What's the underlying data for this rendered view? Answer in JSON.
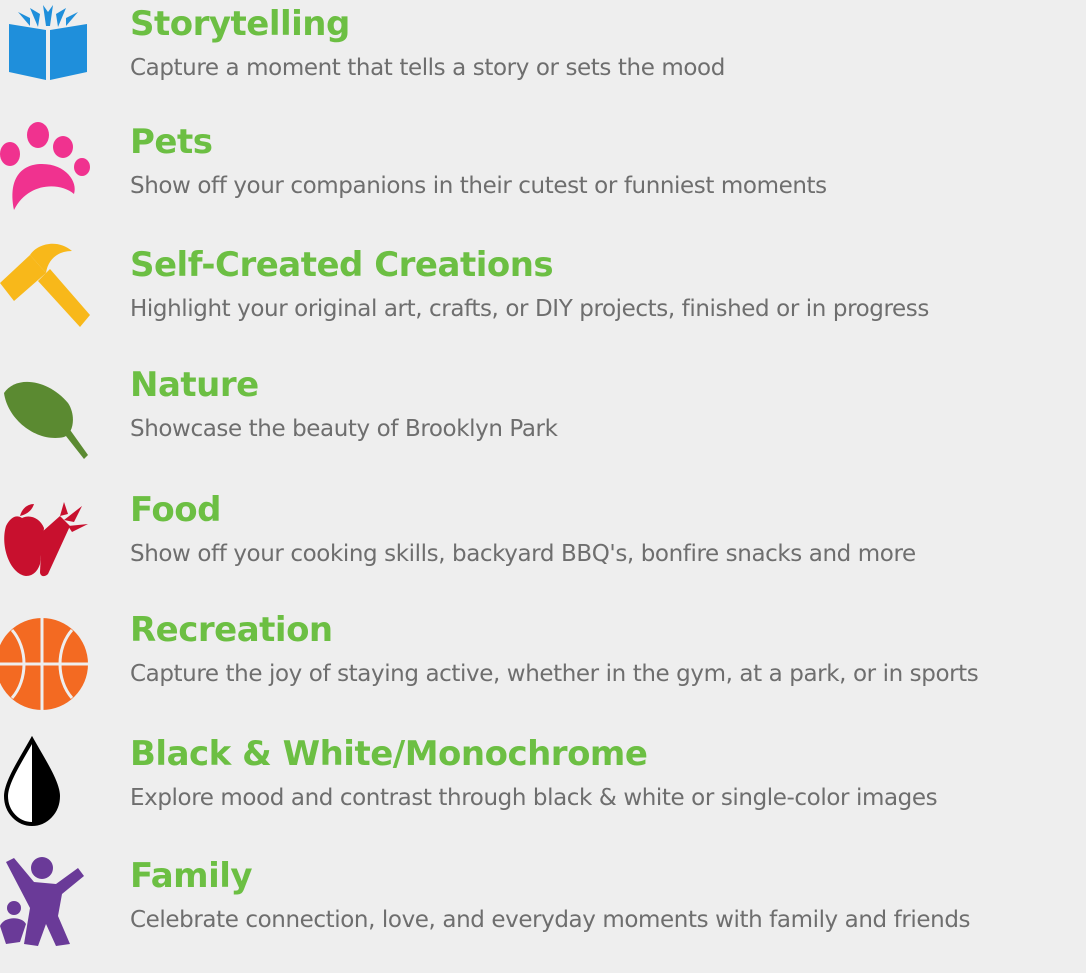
{
  "colors": {
    "title": "#6cbf43",
    "description": "#6e6e6e",
    "background": "#eeeeee",
    "book": "#1f8fdb",
    "paw": "#f0328f",
    "hammer": "#f8b81a",
    "leaf": "#5b8a31",
    "food": "#c8102e",
    "basketball": "#f36a22",
    "drop": "#000000",
    "family": "#6a3a98"
  },
  "categories": [
    {
      "title": "Storytelling",
      "description": "Capture a moment that tells a story or sets the mood",
      "icon": "open-book-icon"
    },
    {
      "title": "Pets",
      "description": "Show off your companions in their cutest or funniest moments",
      "icon": "paw-print-icon"
    },
    {
      "title": "Self-Created Creations",
      "description": "Highlight your original art, crafts, or DIY projects, finished or in progress",
      "icon": "hammer-icon"
    },
    {
      "title": "Nature",
      "description": "Showcase the beauty of Brooklyn Park",
      "icon": "leaf-icon"
    },
    {
      "title": "Food",
      "description": "Show off your cooking skills, backyard BBQ's, bonfire snacks and more",
      "icon": "apple-carrot-icon"
    },
    {
      "title": "Recreation",
      "description": "Capture the joy of staying active, whether in the gym, at a park, or in sports",
      "icon": "basketball-icon"
    },
    {
      "title": "Black & White/Monochrome",
      "description": "Explore mood and contrast through black & white or single-color images",
      "icon": "half-drop-icon"
    },
    {
      "title": "Family",
      "description": "Celebrate connection, love, and everyday moments with family and friends",
      "icon": "family-icon"
    }
  ]
}
